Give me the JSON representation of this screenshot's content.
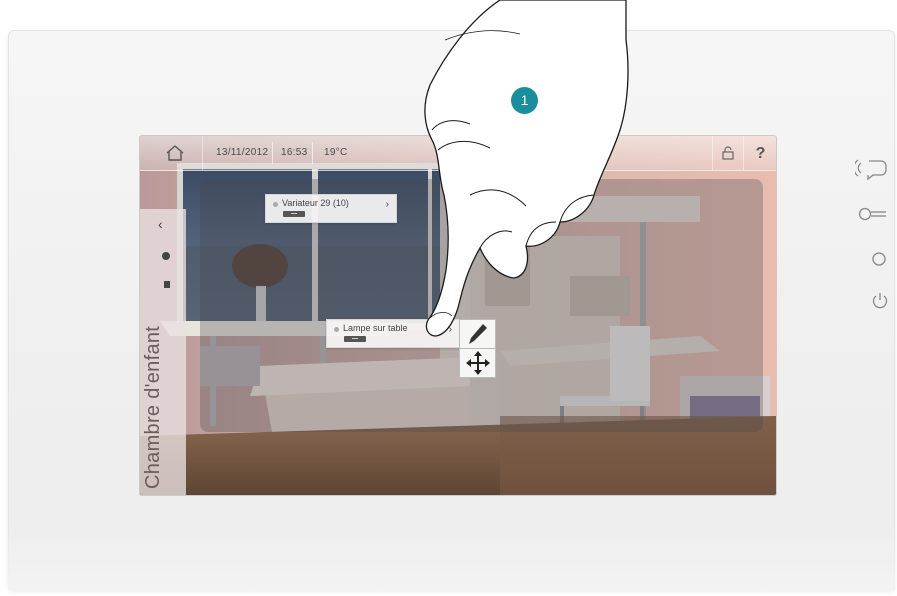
{
  "topbar": {
    "date": "13/11/2012",
    "time": "16:53",
    "temperature": "19°C",
    "help_label": "?"
  },
  "room": {
    "title": "Chambre d'enfant"
  },
  "widgets": [
    {
      "label": "Variateur 29 (10)",
      "chevron": "›"
    },
    {
      "label": "Lampe sur table",
      "chevron": "›"
    }
  ],
  "left_panel": {
    "back_label": "‹"
  },
  "step_badge": "1",
  "icons": {
    "home": "home-icon",
    "lock": "lock-icon",
    "edit": "pencil-icon",
    "move": "move-arrows-icon",
    "intercom": "intercom-icon",
    "key": "key-icon",
    "circle": "circle-button-icon",
    "power": "power-icon"
  },
  "colors": {
    "badge": "#1a8e9c",
    "device": "#f2f2f2"
  }
}
